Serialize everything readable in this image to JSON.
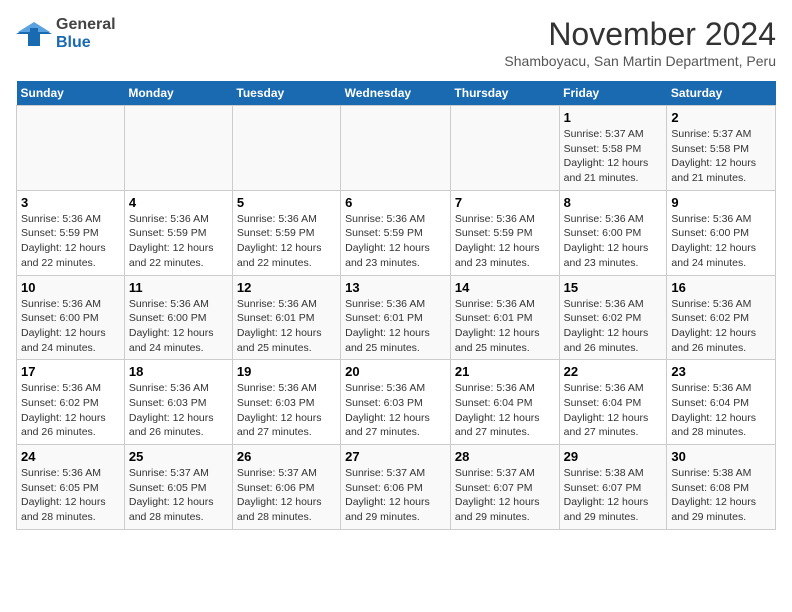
{
  "header": {
    "logo_general": "General",
    "logo_blue": "Blue",
    "title": "November 2024",
    "subtitle": "Shamboyacu, San Martin Department, Peru"
  },
  "days_of_week": [
    "Sunday",
    "Monday",
    "Tuesday",
    "Wednesday",
    "Thursday",
    "Friday",
    "Saturday"
  ],
  "weeks": [
    [
      {
        "day": "",
        "info": ""
      },
      {
        "day": "",
        "info": ""
      },
      {
        "day": "",
        "info": ""
      },
      {
        "day": "",
        "info": ""
      },
      {
        "day": "",
        "info": ""
      },
      {
        "day": "1",
        "info": "Sunrise: 5:37 AM\nSunset: 5:58 PM\nDaylight: 12 hours and 21 minutes."
      },
      {
        "day": "2",
        "info": "Sunrise: 5:37 AM\nSunset: 5:58 PM\nDaylight: 12 hours and 21 minutes."
      }
    ],
    [
      {
        "day": "3",
        "info": "Sunrise: 5:36 AM\nSunset: 5:59 PM\nDaylight: 12 hours and 22 minutes."
      },
      {
        "day": "4",
        "info": "Sunrise: 5:36 AM\nSunset: 5:59 PM\nDaylight: 12 hours and 22 minutes."
      },
      {
        "day": "5",
        "info": "Sunrise: 5:36 AM\nSunset: 5:59 PM\nDaylight: 12 hours and 22 minutes."
      },
      {
        "day": "6",
        "info": "Sunrise: 5:36 AM\nSunset: 5:59 PM\nDaylight: 12 hours and 23 minutes."
      },
      {
        "day": "7",
        "info": "Sunrise: 5:36 AM\nSunset: 5:59 PM\nDaylight: 12 hours and 23 minutes."
      },
      {
        "day": "8",
        "info": "Sunrise: 5:36 AM\nSunset: 6:00 PM\nDaylight: 12 hours and 23 minutes."
      },
      {
        "day": "9",
        "info": "Sunrise: 5:36 AM\nSunset: 6:00 PM\nDaylight: 12 hours and 24 minutes."
      }
    ],
    [
      {
        "day": "10",
        "info": "Sunrise: 5:36 AM\nSunset: 6:00 PM\nDaylight: 12 hours and 24 minutes."
      },
      {
        "day": "11",
        "info": "Sunrise: 5:36 AM\nSunset: 6:00 PM\nDaylight: 12 hours and 24 minutes."
      },
      {
        "day": "12",
        "info": "Sunrise: 5:36 AM\nSunset: 6:01 PM\nDaylight: 12 hours and 25 minutes."
      },
      {
        "day": "13",
        "info": "Sunrise: 5:36 AM\nSunset: 6:01 PM\nDaylight: 12 hours and 25 minutes."
      },
      {
        "day": "14",
        "info": "Sunrise: 5:36 AM\nSunset: 6:01 PM\nDaylight: 12 hours and 25 minutes."
      },
      {
        "day": "15",
        "info": "Sunrise: 5:36 AM\nSunset: 6:02 PM\nDaylight: 12 hours and 26 minutes."
      },
      {
        "day": "16",
        "info": "Sunrise: 5:36 AM\nSunset: 6:02 PM\nDaylight: 12 hours and 26 minutes."
      }
    ],
    [
      {
        "day": "17",
        "info": "Sunrise: 5:36 AM\nSunset: 6:02 PM\nDaylight: 12 hours and 26 minutes."
      },
      {
        "day": "18",
        "info": "Sunrise: 5:36 AM\nSunset: 6:03 PM\nDaylight: 12 hours and 26 minutes."
      },
      {
        "day": "19",
        "info": "Sunrise: 5:36 AM\nSunset: 6:03 PM\nDaylight: 12 hours and 27 minutes."
      },
      {
        "day": "20",
        "info": "Sunrise: 5:36 AM\nSunset: 6:03 PM\nDaylight: 12 hours and 27 minutes."
      },
      {
        "day": "21",
        "info": "Sunrise: 5:36 AM\nSunset: 6:04 PM\nDaylight: 12 hours and 27 minutes."
      },
      {
        "day": "22",
        "info": "Sunrise: 5:36 AM\nSunset: 6:04 PM\nDaylight: 12 hours and 27 minutes."
      },
      {
        "day": "23",
        "info": "Sunrise: 5:36 AM\nSunset: 6:04 PM\nDaylight: 12 hours and 28 minutes."
      }
    ],
    [
      {
        "day": "24",
        "info": "Sunrise: 5:36 AM\nSunset: 6:05 PM\nDaylight: 12 hours and 28 minutes."
      },
      {
        "day": "25",
        "info": "Sunrise: 5:37 AM\nSunset: 6:05 PM\nDaylight: 12 hours and 28 minutes."
      },
      {
        "day": "26",
        "info": "Sunrise: 5:37 AM\nSunset: 6:06 PM\nDaylight: 12 hours and 28 minutes."
      },
      {
        "day": "27",
        "info": "Sunrise: 5:37 AM\nSunset: 6:06 PM\nDaylight: 12 hours and 29 minutes."
      },
      {
        "day": "28",
        "info": "Sunrise: 5:37 AM\nSunset: 6:07 PM\nDaylight: 12 hours and 29 minutes."
      },
      {
        "day": "29",
        "info": "Sunrise: 5:38 AM\nSunset: 6:07 PM\nDaylight: 12 hours and 29 minutes."
      },
      {
        "day": "30",
        "info": "Sunrise: 5:38 AM\nSunset: 6:08 PM\nDaylight: 12 hours and 29 minutes."
      }
    ]
  ]
}
